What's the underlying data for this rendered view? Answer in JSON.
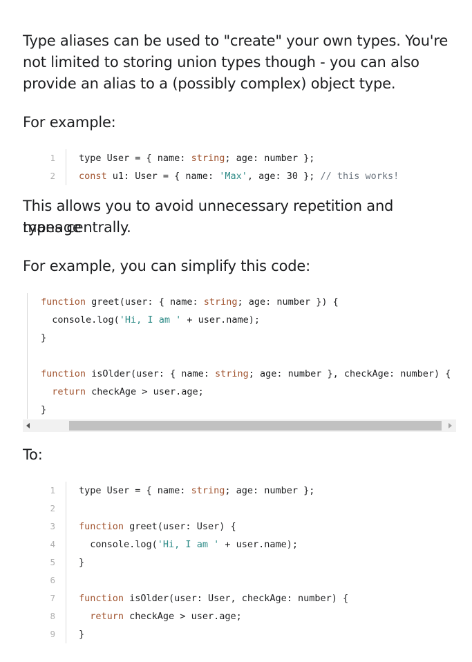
{
  "paragraphs": {
    "intro_1": "Type aliases can be used to \"create\" your own types. You're",
    "intro_2": "not limited to storing union types though - you can also",
    "intro_3": "provide an alias to a (possibly complex) object type.",
    "example_1": "For example:",
    "allows_1": "This allows you to avoid unnecessary repetition and manage",
    "allows_2": "types centrally.",
    "example_2": "For example, you can simplify this code:",
    "to": "To:"
  },
  "code1": {
    "line_numbers": [
      "1",
      "2"
    ],
    "l1": {
      "a": "type User = { name: ",
      "b": "string",
      "c": "; age: number };"
    },
    "l2": {
      "kw": "const",
      "a": " u1: User = { name: ",
      "s": "'Max'",
      "b": ", age: 30 }; ",
      "cm": "// this works!"
    }
  },
  "code2": {
    "l1": {
      "kw": "function",
      "a": " greet(user: { name: ",
      "s": "string",
      "b": "; age: number }) {"
    },
    "l2": {
      "a": "  console.log(",
      "s": "'Hi, I am '",
      "b": " + user.name);"
    },
    "l3": "}",
    "l5": {
      "kw": "function",
      "a": " isOlder(user: { name: ",
      "s": "string",
      "b": "; age: number }, checkAge: number) {"
    },
    "l6": {
      "kw": "  return",
      "a": " checkAge > user.age;"
    },
    "l7": "}"
  },
  "code3": {
    "line_numbers": [
      "1",
      "2",
      "3",
      "4",
      "5",
      "6",
      "7",
      "8",
      "9"
    ],
    "l1": {
      "a": "type User = { name: ",
      "s": "string",
      "b": "; age: number };"
    },
    "l3": {
      "kw": "function",
      "a": " greet(user: User) {"
    },
    "l4": {
      "a": "  console.log(",
      "s": "'Hi, I am '",
      "b": " + user.name);"
    },
    "l5": "}",
    "l7": {
      "kw": "function",
      "a": " isOlder(user: User, checkAge: number) {"
    },
    "l8": {
      "kw": "  return",
      "a": " checkAge > user.age;"
    },
    "l9": "}"
  }
}
